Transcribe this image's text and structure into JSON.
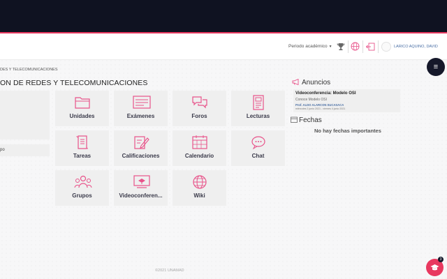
{
  "navbar": {
    "period_label": "Periodo académico",
    "username": "LARICO AQUINO, DAVID"
  },
  "breadcrumb": "DES Y TELECOMUNICACIONES",
  "course_title": "ON DE REDES Y TELECOMUNICACIONES",
  "left_panel": {
    "item_label": "po"
  },
  "tiles": [
    {
      "label": "Unidades",
      "icon": "folder-icon"
    },
    {
      "label": "Exámenes",
      "icon": "exam-icon"
    },
    {
      "label": "Foros",
      "icon": "forum-icon"
    },
    {
      "label": "Lecturas",
      "icon": "reading-icon"
    },
    {
      "label": "Tareas",
      "icon": "scroll-icon"
    },
    {
      "label": "Calificaciones",
      "icon": "grades-icon"
    },
    {
      "label": "Calendario",
      "icon": "calendar-icon"
    },
    {
      "label": "Chat",
      "icon": "chat-icon"
    },
    {
      "label": "Grupos",
      "icon": "group-icon"
    },
    {
      "label": "Videoconferen...",
      "icon": "video-icon"
    },
    {
      "label": "Wiki",
      "icon": "globe-icon"
    }
  ],
  "announcements": {
    "heading": "Anuncios",
    "item": {
      "title": "Videoconferencia: Modelo OSI",
      "subtitle": "Conoce Modelo OSI",
      "professor": "Prof. ALDO ALARCON SUCASACA",
      "dates": "miércoles 2 junio 2021 - viernes 4 junio 2021"
    }
  },
  "dates_section": {
    "heading": "Fechas",
    "empty_message": "No hay fechas importantes"
  },
  "footer": "©2021 UNAMAD",
  "fab": {
    "badge": "3"
  },
  "colors": {
    "accent": "#e8385f",
    "dark": "#0f1221",
    "icon": "#e8538a"
  }
}
